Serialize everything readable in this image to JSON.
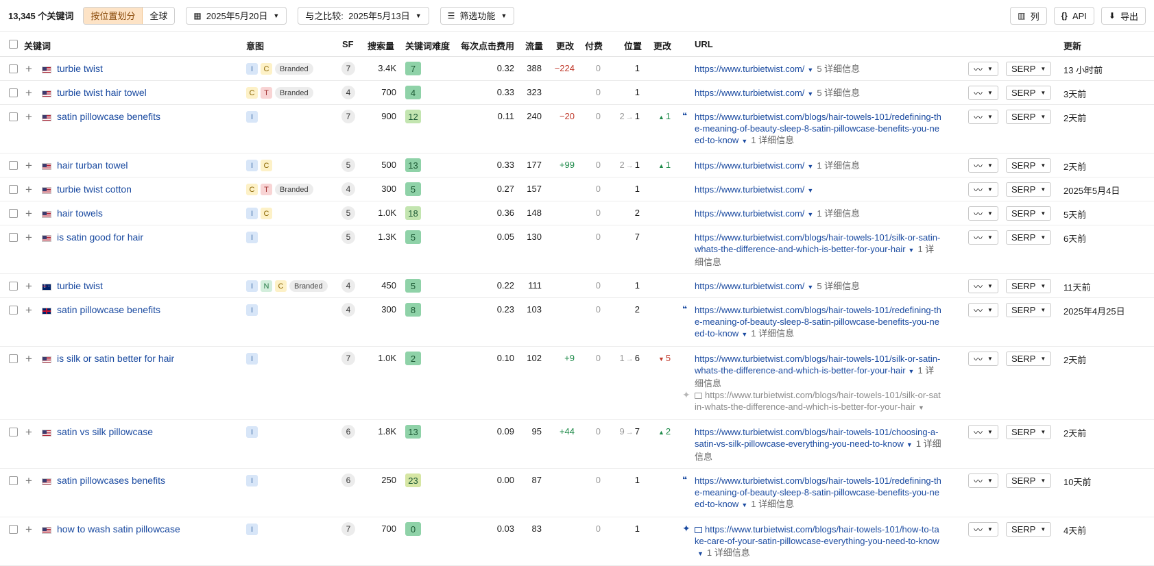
{
  "toolbar": {
    "count": "13,345 个关键词",
    "seg": [
      "按位置划分",
      "全球"
    ],
    "date_label": "2025年5月20日",
    "compare_label": "与之比较:  2025年5月13日",
    "filter_label": "筛选功能",
    "columns_label": "列",
    "api_label": "API",
    "export_label": "导出"
  },
  "header": {
    "keyword": "关键词",
    "intent": "意图",
    "sf": "SF",
    "volume": "搜索量",
    "kd": "关键词难度",
    "cpc": "每次点击费用",
    "traffic": "流量",
    "traffic_change": "更改",
    "paid": "付费",
    "position": "位置",
    "position_change": "更改",
    "url": "URL",
    "updated": "更新"
  },
  "rows": [
    {
      "flag": "us",
      "kw": "turbie twist",
      "intents": [
        "I",
        "C",
        "Branded"
      ],
      "sf": "7",
      "vol": "3.4K",
      "kd": "7",
      "kdc": "g",
      "cpc": "0.32",
      "traffic": "388",
      "tchg": "−224",
      "tchgc": "neg",
      "paid": "0",
      "pos_from": "",
      "pos": "1",
      "pchg": "",
      "pdir": "",
      "quote": false,
      "url": "https://www.turbietwist.com/",
      "more": "5 详细信息",
      "sub": "",
      "upd": "13 小时前"
    },
    {
      "flag": "us",
      "kw": "turbie twist hair towel",
      "intents": [
        "C",
        "T",
        "Branded"
      ],
      "sf": "4",
      "vol": "700",
      "kd": "4",
      "kdc": "g",
      "cpc": "0.33",
      "traffic": "323",
      "tchg": "",
      "tchgc": "",
      "paid": "0",
      "pos_from": "",
      "pos": "1",
      "pchg": "",
      "pdir": "",
      "quote": false,
      "url": "https://www.turbietwist.com/",
      "more": "5 详细信息",
      "sub": "",
      "upd": "3天前"
    },
    {
      "flag": "us",
      "kw": "satin pillowcase benefits",
      "intents": [
        "I"
      ],
      "sf": "7",
      "vol": "900",
      "kd": "12",
      "kdc": "l",
      "cpc": "0.11",
      "traffic": "240",
      "tchg": "−20",
      "tchgc": "neg",
      "paid": "0",
      "pos_from": "2",
      "pos": "1",
      "pchg": "1",
      "pdir": "up",
      "quote": true,
      "url": "https://www.turbietwist.com/blogs/hair-towels-101/redefining-the-meaning-of-beauty-sleep-8-satin-pillowcase-benefits-you-need-to-know",
      "more": "1 详细信息",
      "sub": "",
      "upd": "2天前"
    },
    {
      "flag": "us",
      "kw": "hair turban towel",
      "intents": [
        "I",
        "C"
      ],
      "sf": "5",
      "vol": "500",
      "kd": "13",
      "kdc": "g",
      "cpc": "0.33",
      "traffic": "177",
      "tchg": "+99",
      "tchgc": "pos",
      "paid": "0",
      "pos_from": "2",
      "pos": "1",
      "pchg": "1",
      "pdir": "up",
      "quote": false,
      "url": "https://www.turbietwist.com/",
      "more": "1 详细信息",
      "sub": "",
      "upd": "2天前"
    },
    {
      "flag": "us",
      "kw": "turbie twist cotton",
      "intents": [
        "C",
        "T",
        "Branded"
      ],
      "sf": "4",
      "vol": "300",
      "kd": "5",
      "kdc": "g",
      "cpc": "0.27",
      "traffic": "157",
      "tchg": "",
      "tchgc": "",
      "paid": "0",
      "pos_from": "",
      "pos": "1",
      "pchg": "",
      "pdir": "",
      "quote": false,
      "url": "https://www.turbietwist.com/",
      "more": "",
      "sub": "",
      "upd": "2025年5月4日"
    },
    {
      "flag": "us",
      "kw": "hair towels",
      "intents": [
        "I",
        "C"
      ],
      "sf": "5",
      "vol": "1.0K",
      "kd": "18",
      "kdc": "l",
      "cpc": "0.36",
      "traffic": "148",
      "tchg": "",
      "tchgc": "",
      "paid": "0",
      "pos_from": "",
      "pos": "2",
      "pchg": "",
      "pdir": "",
      "quote": false,
      "url": "https://www.turbietwist.com/",
      "more": "1 详细信息",
      "sub": "",
      "upd": "5天前"
    },
    {
      "flag": "us",
      "kw": "is satin good for hair",
      "intents": [
        "I"
      ],
      "sf": "5",
      "vol": "1.3K",
      "kd": "5",
      "kdc": "g",
      "cpc": "0.05",
      "traffic": "130",
      "tchg": "",
      "tchgc": "",
      "paid": "0",
      "pos_from": "",
      "pos": "7",
      "pchg": "",
      "pdir": "",
      "quote": false,
      "url": "https://www.turbietwist.com/blogs/hair-towels-101/silk-or-satin-whats-the-difference-and-which-is-better-for-your-hair",
      "more": "1 详细信息",
      "sub": "",
      "upd": "6天前"
    },
    {
      "flag": "au",
      "kw": "turbie twist",
      "intents": [
        "I",
        "N",
        "C",
        "Branded"
      ],
      "sf": "4",
      "vol": "450",
      "kd": "5",
      "kdc": "g",
      "cpc": "0.22",
      "traffic": "111",
      "tchg": "",
      "tchgc": "",
      "paid": "0",
      "pos_from": "",
      "pos": "1",
      "pchg": "",
      "pdir": "",
      "quote": false,
      "url": "https://www.turbietwist.com/",
      "more": "5 详细信息",
      "sub": "",
      "upd": "11天前"
    },
    {
      "flag": "gb",
      "kw": "satin pillowcase benefits",
      "intents": [
        "I"
      ],
      "sf": "4",
      "vol": "300",
      "kd": "8",
      "kdc": "g",
      "cpc": "0.23",
      "traffic": "103",
      "tchg": "",
      "tchgc": "",
      "paid": "0",
      "pos_from": "",
      "pos": "2",
      "pchg": "",
      "pdir": "",
      "quote": true,
      "url": "https://www.turbietwist.com/blogs/hair-towels-101/redefining-the-meaning-of-beauty-sleep-8-satin-pillowcase-benefits-you-need-to-know",
      "more": "1 详细信息",
      "sub": "",
      "upd": "2025年4月25日"
    },
    {
      "flag": "us",
      "kw": "is silk or satin better for hair",
      "intents": [
        "I"
      ],
      "sf": "7",
      "vol": "1.0K",
      "kd": "2",
      "kdc": "g",
      "cpc": "0.10",
      "traffic": "102",
      "tchg": "+9",
      "tchgc": "pos",
      "paid": "0",
      "pos_from": "1",
      "pos": "6",
      "pchg": "5",
      "pdir": "dn",
      "quote": false,
      "url": "https://www.turbietwist.com/blogs/hair-towels-101/silk-or-satin-whats-the-difference-and-which-is-better-for-your-hair",
      "more": "1 详细信息",
      "sub": "https://www.turbietwist.com/blogs/hair-towels-101/silk-or-satin-whats-the-difference-and-which-is-better-for-your-hair",
      "upd": "2天前"
    },
    {
      "flag": "us",
      "kw": "satin vs silk pillowcase",
      "intents": [
        "I"
      ],
      "sf": "6",
      "vol": "1.8K",
      "kd": "13",
      "kdc": "g",
      "cpc": "0.09",
      "traffic": "95",
      "tchg": "+44",
      "tchgc": "pos",
      "paid": "0",
      "pos_from": "9",
      "pos": "7",
      "pchg": "2",
      "pdir": "up",
      "quote": false,
      "url": "https://www.turbietwist.com/blogs/hair-towels-101/choosing-a-satin-vs-silk-pillowcase-everything-you-need-to-know",
      "more": "1 详细信息",
      "sub": "",
      "upd": "2天前"
    },
    {
      "flag": "us",
      "kw": "satin pillowcases benefits",
      "intents": [
        "I"
      ],
      "sf": "6",
      "vol": "250",
      "kd": "23",
      "kdc": "y",
      "cpc": "0.00",
      "traffic": "87",
      "tchg": "",
      "tchgc": "",
      "paid": "0",
      "pos_from": "",
      "pos": "1",
      "pchg": "",
      "pdir": "",
      "quote": true,
      "url": "https://www.turbietwist.com/blogs/hair-towels-101/redefining-the-meaning-of-beauty-sleep-8-satin-pillowcase-benefits-you-need-to-know",
      "more": "1 详细信息",
      "sub": "",
      "upd": "10天前"
    },
    {
      "flag": "us",
      "kw": "how to wash satin pillowcase",
      "intents": [
        "I"
      ],
      "sf": "7",
      "vol": "700",
      "kd": "0",
      "kdc": "g",
      "cpc": "0.03",
      "traffic": "83",
      "tchg": "",
      "tchgc": "",
      "paid": "0",
      "pos_from": "",
      "pos": "1",
      "pchg": "",
      "pdir": "",
      "quote": false,
      "spark_img": true,
      "url": "https://www.turbietwist.com/blogs/hair-towels-101/how-to-take-care-of-your-satin-pillowcase-everything-you-need-to-know",
      "more": "1 详细信息",
      "sub": "",
      "upd": "4天前"
    }
  ],
  "row_buttons": {
    "serp_label": "SERP"
  }
}
